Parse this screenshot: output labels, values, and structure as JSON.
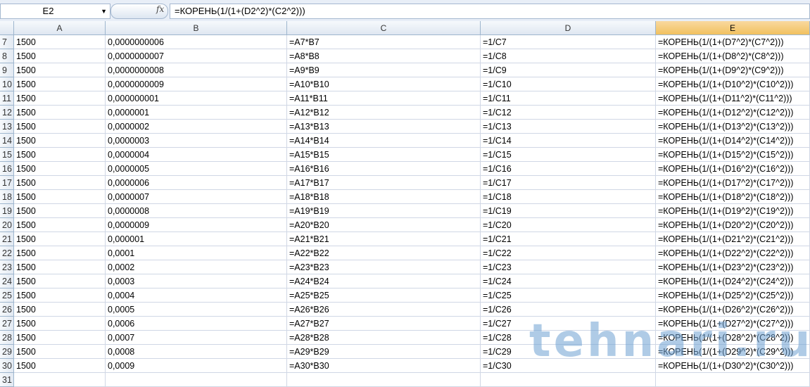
{
  "formula_bar": {
    "name_box": "E2",
    "fx_label": "fx",
    "formula": "=КОРЕНЬ(1/(1+(D2^2)*(C2^2)))"
  },
  "columns": [
    "A",
    "B",
    "C",
    "D",
    "E"
  ],
  "selected_column": "E",
  "rows": [
    [
      "7",
      "1500",
      "0,0000000006",
      "=A7*B7",
      "=1/C7",
      "=КОРЕНЬ(1/(1+(D7^2)*(C7^2)))"
    ],
    [
      "8",
      "1500",
      "0,0000000007",
      "=A8*B8",
      "=1/C8",
      "=КОРЕНЬ(1/(1+(D8^2)*(C8^2)))"
    ],
    [
      "9",
      "1500",
      "0,0000000008",
      "=A9*B9",
      "=1/C9",
      "=КОРЕНЬ(1/(1+(D9^2)*(C9^2)))"
    ],
    [
      "10",
      "1500",
      "0,0000000009",
      "=A10*B10",
      "=1/C10",
      "=КОРЕНЬ(1/(1+(D10^2)*(C10^2)))"
    ],
    [
      "11",
      "1500",
      "0,000000001",
      "=A11*B11",
      "=1/C11",
      "=КОРЕНЬ(1/(1+(D11^2)*(C11^2)))"
    ],
    [
      "12",
      "1500",
      "0,0000001",
      "=A12*B12",
      "=1/C12",
      "=КОРЕНЬ(1/(1+(D12^2)*(C12^2)))"
    ],
    [
      "13",
      "1500",
      "0,0000002",
      "=A13*B13",
      "=1/C13",
      "=КОРЕНЬ(1/(1+(D13^2)*(C13^2)))"
    ],
    [
      "14",
      "1500",
      "0,0000003",
      "=A14*B14",
      "=1/C14",
      "=КОРЕНЬ(1/(1+(D14^2)*(C14^2)))"
    ],
    [
      "15",
      "1500",
      "0,0000004",
      "=A15*B15",
      "=1/C15",
      "=КОРЕНЬ(1/(1+(D15^2)*(C15^2)))"
    ],
    [
      "16",
      "1500",
      "0,0000005",
      "=A16*B16",
      "=1/C16",
      "=КОРЕНЬ(1/(1+(D16^2)*(C16^2)))"
    ],
    [
      "17",
      "1500",
      "0,0000006",
      "=A17*B17",
      "=1/C17",
      "=КОРЕНЬ(1/(1+(D17^2)*(C17^2)))"
    ],
    [
      "18",
      "1500",
      "0,0000007",
      "=A18*B18",
      "=1/C18",
      "=КОРЕНЬ(1/(1+(D18^2)*(C18^2)))"
    ],
    [
      "19",
      "1500",
      "0,0000008",
      "=A19*B19",
      "=1/C19",
      "=КОРЕНЬ(1/(1+(D19^2)*(C19^2)))"
    ],
    [
      "20",
      "1500",
      "0,0000009",
      "=A20*B20",
      "=1/C20",
      "=КОРЕНЬ(1/(1+(D20^2)*(C20^2)))"
    ],
    [
      "21",
      "1500",
      "0,000001",
      "=A21*B21",
      "=1/C21",
      "=КОРЕНЬ(1/(1+(D21^2)*(C21^2)))"
    ],
    [
      "22",
      "1500",
      "0,0001",
      "=A22*B22",
      "=1/C22",
      "=КОРЕНЬ(1/(1+(D22^2)*(C22^2)))"
    ],
    [
      "23",
      "1500",
      "0,0002",
      "=A23*B23",
      "=1/C23",
      "=КОРЕНЬ(1/(1+(D23^2)*(C23^2)))"
    ],
    [
      "24",
      "1500",
      "0,0003",
      "=A24*B24",
      "=1/C24",
      "=КОРЕНЬ(1/(1+(D24^2)*(C24^2)))"
    ],
    [
      "25",
      "1500",
      "0,0004",
      "=A25*B25",
      "=1/C25",
      "=КОРЕНЬ(1/(1+(D25^2)*(C25^2)))"
    ],
    [
      "26",
      "1500",
      "0,0005",
      "=A26*B26",
      "=1/C26",
      "=КОРЕНЬ(1/(1+(D26^2)*(C26^2)))"
    ],
    [
      "27",
      "1500",
      "0,0006",
      "=A27*B27",
      "=1/C27",
      "=КОРЕНЬ(1/(1+(D27^2)*(C27^2)))"
    ],
    [
      "28",
      "1500",
      "0,0007",
      "=A28*B28",
      "=1/C28",
      "=КОРЕНЬ(1/(1+(D28^2)*(C28^2)))"
    ],
    [
      "29",
      "1500",
      "0,0008",
      "=A29*B29",
      "=1/C29",
      "=КОРЕНЬ(1/(1+(D29^2)*(C29^2)))"
    ],
    [
      "30",
      "1500",
      "0,0009",
      "=A30*B30",
      "=1/C30",
      "=КОРЕНЬ(1/(1+(D30^2)*(C30^2)))"
    ],
    [
      "31",
      "",
      "",
      "",
      "",
      ""
    ]
  ],
  "watermark": "tehnari.ru"
}
